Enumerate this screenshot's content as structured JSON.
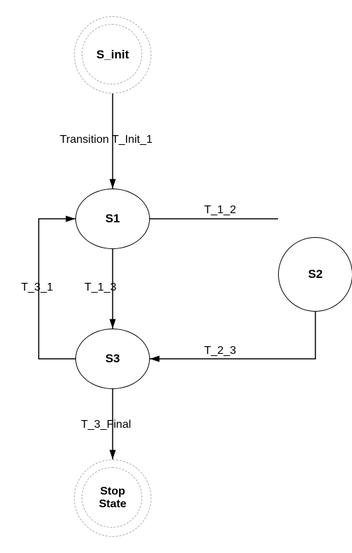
{
  "diagram": {
    "states": {
      "s_init": "S_init",
      "s1": "S1",
      "s2": "S2",
      "s3": "S3",
      "stop": "Stop\nState"
    },
    "transitions": {
      "t_init_1": "Transition T_Init_1",
      "t_1_2": "T_1_2",
      "t_1_3": "T_1_3",
      "t_2_3": "T_2_3",
      "t_3_1": "T_3_1",
      "t_3_final": "T_3_Final"
    }
  }
}
